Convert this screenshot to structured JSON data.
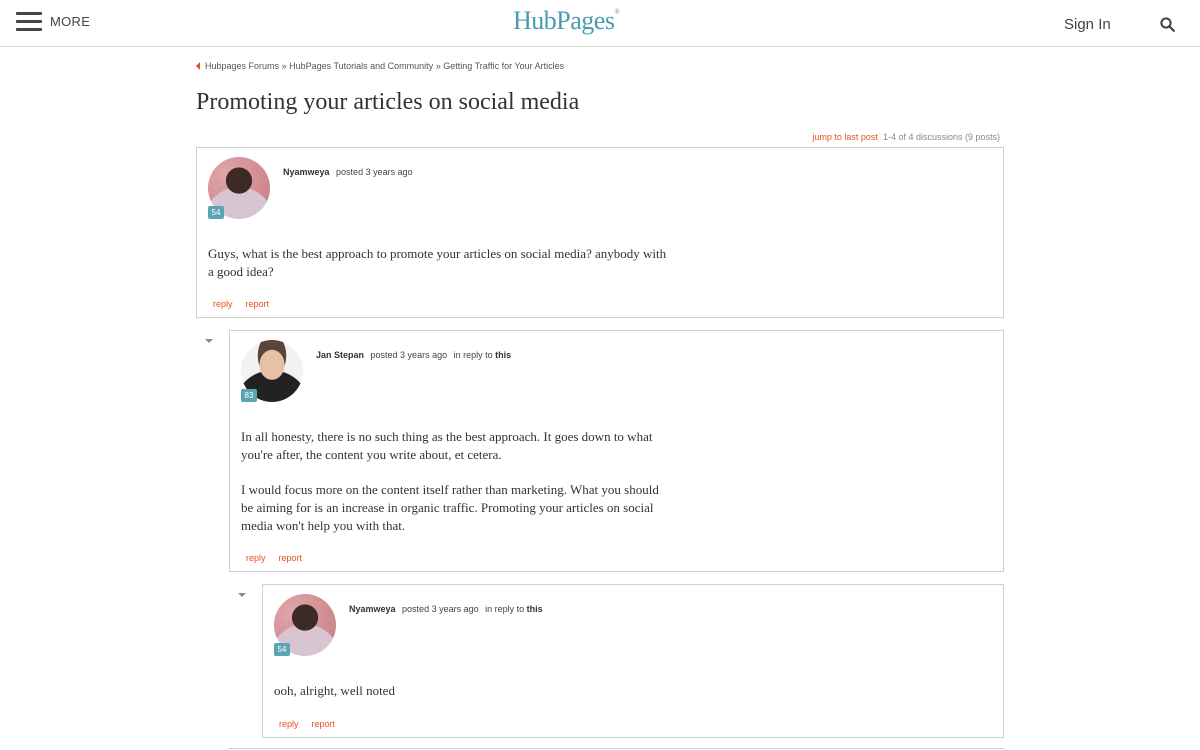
{
  "header": {
    "menu_label": "MORE",
    "logo": "HubPages",
    "logo_mark": "®",
    "signin_label": "Sign In"
  },
  "breadcrumb": {
    "items": [
      "Hubpages Forums",
      "HubPages Tutorials and Community",
      "Getting Traffic for Your Articles"
    ],
    "separator": "»"
  },
  "thread": {
    "title": "Promoting your articles on social media",
    "jump_label": "jump to last post",
    "count_text": "1-4 of 4 discussions (9 posts)"
  },
  "posts": [
    {
      "author": "Nyamweya",
      "posted": "posted 3 years ago",
      "badge": "54",
      "body": [
        "Guys, what is the best approach to promote your articles on social media? anybody with a good idea?"
      ],
      "reply_label": "reply",
      "report_label": "report"
    },
    {
      "author": "Jan Stepan",
      "posted": "posted 3 years ago",
      "in_reply_to": "in reply to",
      "reply_target": "this",
      "badge": "83",
      "body": [
        "In all honesty, there is no such thing as the best approach. It goes down to what you're after, the content you write about, et cetera.",
        "I would focus more on the content itself rather than marketing. What you should be aiming for is an increase in organic traffic. Promoting your articles on social media won't help you with that."
      ],
      "reply_label": "reply",
      "report_label": "report"
    },
    {
      "author": "Nyamweya",
      "posted": "posted 3 years ago",
      "in_reply_to": "in reply to",
      "reply_target": "this",
      "badge": "54",
      "body": [
        "ooh, alright, well noted"
      ],
      "reply_label": "reply",
      "report_label": "report"
    }
  ],
  "colors": {
    "accent": "#e4521f",
    "brand": "#4a9bb0",
    "badge": "#5ba4b3"
  },
  "icons": {
    "menu": "hamburger-icon",
    "search": "search-icon",
    "back": "back-arrow-icon",
    "collapse": "collapse-arrow-icon"
  }
}
